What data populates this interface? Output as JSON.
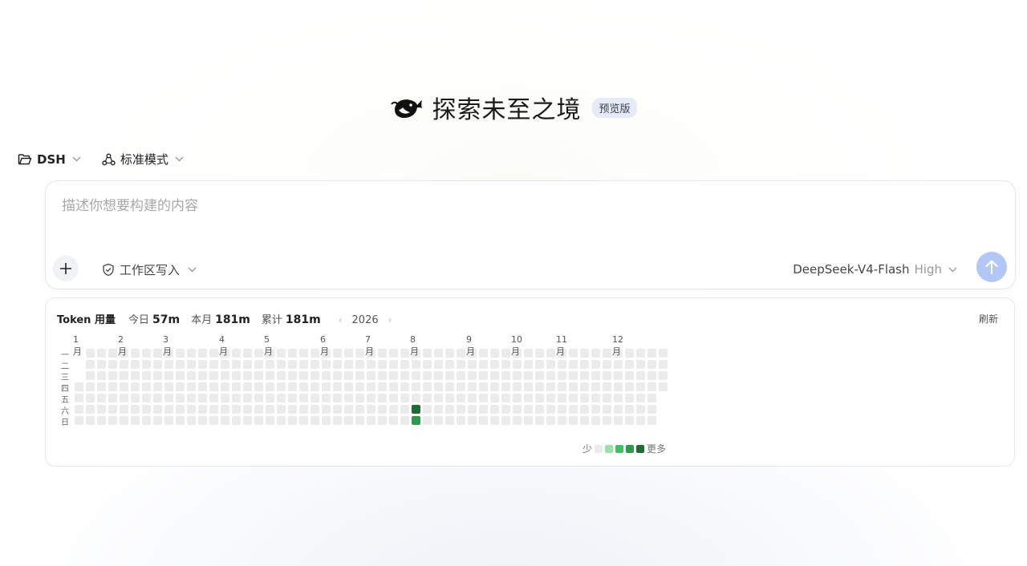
{
  "header": {
    "title": "探索未至之境",
    "badge": "预览版",
    "logo_icon": "whale-icon"
  },
  "toolbar": {
    "folder_label": "DSH",
    "mode_label": "标准模式"
  },
  "composer": {
    "placeholder": "描述你想要构建的内容",
    "workspace_label": "工作区写入",
    "model_name": "DeepSeek-V4-Flash",
    "model_level": "High"
  },
  "usage": {
    "title": "Token 用量",
    "today_label": "今日",
    "today_value": "57m",
    "month_label": "本月",
    "month_value": "181m",
    "total_label": "累计",
    "total_value": "181m",
    "year": "2026",
    "prev_icon": "‹",
    "next_icon": "›",
    "refresh_label": "刷新",
    "months": [
      "1月",
      "2月",
      "3月",
      "4月",
      "5月",
      "6月",
      "7月",
      "8月",
      "9月",
      "10月",
      "11月",
      "12月"
    ],
    "weekdays": [
      "一",
      "二",
      "三",
      "四",
      "五",
      "六",
      "日"
    ],
    "legend_less": "少",
    "legend_more": "更多",
    "colors": [
      "#ebebeb",
      "#9be0a8",
      "#40bf63",
      "#2e9a4d",
      "#1f6b35"
    ],
    "active_days": [
      {
        "date": "2026-08-01",
        "level": 4
      },
      {
        "date": "2026-08-02",
        "level": 3
      }
    ]
  }
}
